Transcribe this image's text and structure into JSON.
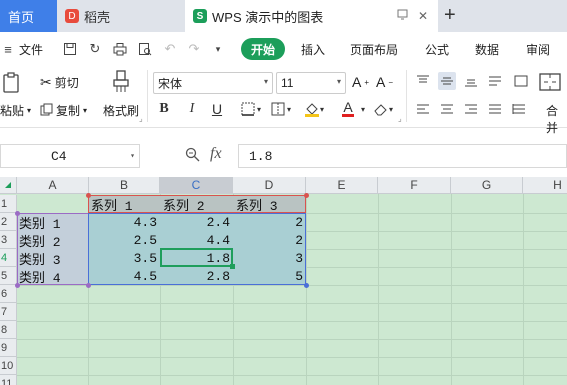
{
  "tabs": [
    {
      "label": "首页"
    },
    {
      "label": "稻壳"
    },
    {
      "label": "WPS 演示中的图表"
    }
  ],
  "menu": {
    "file": "文件",
    "items": [
      "开始",
      "插入",
      "页面布局",
      "公式",
      "数据",
      "审阅"
    ]
  },
  "ribbon": {
    "paste": "粘贴",
    "cut": "剪切",
    "copy": "复制",
    "format_painter": "格式刷",
    "font_name": "宋体",
    "font_size": "11",
    "merge": "合并"
  },
  "formula_bar": {
    "cell_ref": "C4",
    "value": "1.8"
  },
  "grid": {
    "columns": [
      "A",
      "B",
      "C",
      "D",
      "E",
      "F",
      "G",
      "H"
    ],
    "rows": [
      "1",
      "2",
      "3",
      "4",
      "5",
      "6",
      "7",
      "8",
      "9",
      "10",
      "11"
    ],
    "header_row": [
      "",
      "系列 1",
      "系列 2",
      "系列 3"
    ],
    "data_rows": [
      [
        "类别 1",
        "4.3",
        "2.4",
        "2"
      ],
      [
        "类别 2",
        "2.5",
        "4.4",
        "2"
      ],
      [
        "类别 3",
        "3.5",
        "1.8",
        "3"
      ],
      [
        "类别 4",
        "4.5",
        "2.8",
        "5"
      ]
    ]
  },
  "colors": {
    "accent": "#1c9e5a",
    "home_tab": "#3f7fe8",
    "sheet_background": "#cde8d1"
  }
}
